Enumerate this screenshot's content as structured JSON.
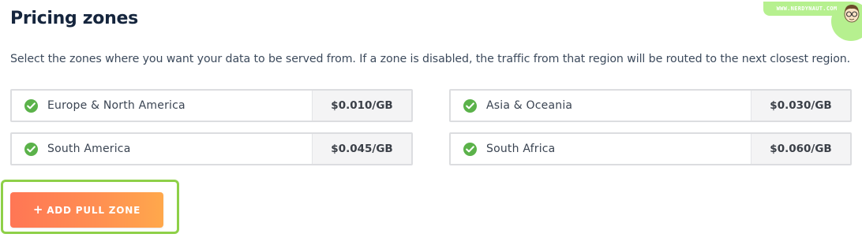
{
  "header": {
    "title": "Pricing zones",
    "description": "Select the zones where you want your data to be served from. If a zone is disabled, the traffic from that region will be routed to the next closest region."
  },
  "zones": [
    {
      "name": "Europe & North America",
      "price": "$0.010/GB",
      "enabled": true,
      "icon": "check-circle-icon"
    },
    {
      "name": "Asia & Oceania",
      "price": "$0.030/GB",
      "enabled": true,
      "icon": "check-circle-icon"
    },
    {
      "name": "South America",
      "price": "$0.045/GB",
      "enabled": true,
      "icon": "check-circle-icon"
    },
    {
      "name": "South Africa",
      "price": "$0.060/GB",
      "enabled": true,
      "icon": "check-circle-icon"
    }
  ],
  "actions": {
    "add_pull_zone_label": "ADD PULL ZONE"
  },
  "watermark": {
    "text": "WWW.NERDYNAUT.COM"
  },
  "colors": {
    "title": "#15253d",
    "check": "#5bb24a",
    "button_gradient_start": "#ff7655",
    "button_gradient_end": "#ffa84c",
    "highlight": "#8ed048"
  }
}
